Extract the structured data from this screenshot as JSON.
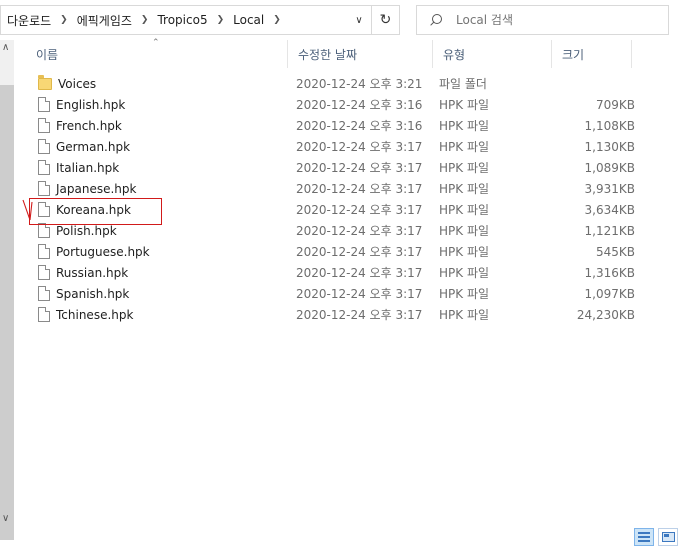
{
  "address_bar": {
    "breadcrumbs": [
      "다운로드",
      "에픽게임즈",
      "Tropico5",
      "Local"
    ],
    "separator_icon": "chevron-right-icon",
    "history_dropdown_icon": "chevron-down-icon",
    "refresh_icon": "refresh-icon"
  },
  "search": {
    "placeholder": "Local 검색",
    "icon": "search-icon"
  },
  "columns": {
    "name": "이름",
    "date": "수정한 날짜",
    "type": "유형",
    "size": "크기"
  },
  "sort_indicator_icon": "sort-up-icon",
  "files": [
    {
      "name": "Voices",
      "icon": "folder-icon",
      "date": "2020-12-24 오후 3:21",
      "type": "파일 폴더",
      "size": ""
    },
    {
      "name": "English.hpk",
      "icon": "file-icon",
      "date": "2020-12-24 오후 3:16",
      "type": "HPK 파일",
      "size": "709KB"
    },
    {
      "name": "French.hpk",
      "icon": "file-icon",
      "date": "2020-12-24 오후 3:16",
      "type": "HPK 파일",
      "size": "1,108KB"
    },
    {
      "name": "German.hpk",
      "icon": "file-icon",
      "date": "2020-12-24 오후 3:17",
      "type": "HPK 파일",
      "size": "1,130KB"
    },
    {
      "name": "Italian.hpk",
      "icon": "file-icon",
      "date": "2020-12-24 오후 3:17",
      "type": "HPK 파일",
      "size": "1,089KB"
    },
    {
      "name": "Japanese.hpk",
      "icon": "file-icon",
      "date": "2020-12-24 오후 3:17",
      "type": "HPK 파일",
      "size": "3,931KB"
    },
    {
      "name": "Koreana.hpk",
      "icon": "file-icon",
      "date": "2020-12-24 오후 3:17",
      "type": "HPK 파일",
      "size": "3,634KB"
    },
    {
      "name": "Polish.hpk",
      "icon": "file-icon",
      "date": "2020-12-24 오후 3:17",
      "type": "HPK 파일",
      "size": "1,121KB"
    },
    {
      "name": "Portuguese.hpk",
      "icon": "file-icon",
      "date": "2020-12-24 오후 3:17",
      "type": "HPK 파일",
      "size": "545KB"
    },
    {
      "name": "Russian.hpk",
      "icon": "file-icon",
      "date": "2020-12-24 오후 3:17",
      "type": "HPK 파일",
      "size": "1,316KB"
    },
    {
      "name": "Spanish.hpk",
      "icon": "file-icon",
      "date": "2020-12-24 오후 3:17",
      "type": "HPK 파일",
      "size": "1,097KB"
    },
    {
      "name": "Tchinese.hpk",
      "icon": "file-icon",
      "date": "2020-12-24 오후 3:17",
      "type": "HPK 파일",
      "size": "24,230KB"
    }
  ],
  "annotation": {
    "highlighted_item": "Koreana.hpk",
    "color": "#d11a1a"
  },
  "view_buttons": [
    {
      "icon": "details-view-icon",
      "active": true
    },
    {
      "icon": "large-icons-view-icon",
      "active": false
    }
  ],
  "colors": {
    "header_text": "#4c607a",
    "secondary_text": "#6d6d6d",
    "folder": "#f8d775"
  }
}
